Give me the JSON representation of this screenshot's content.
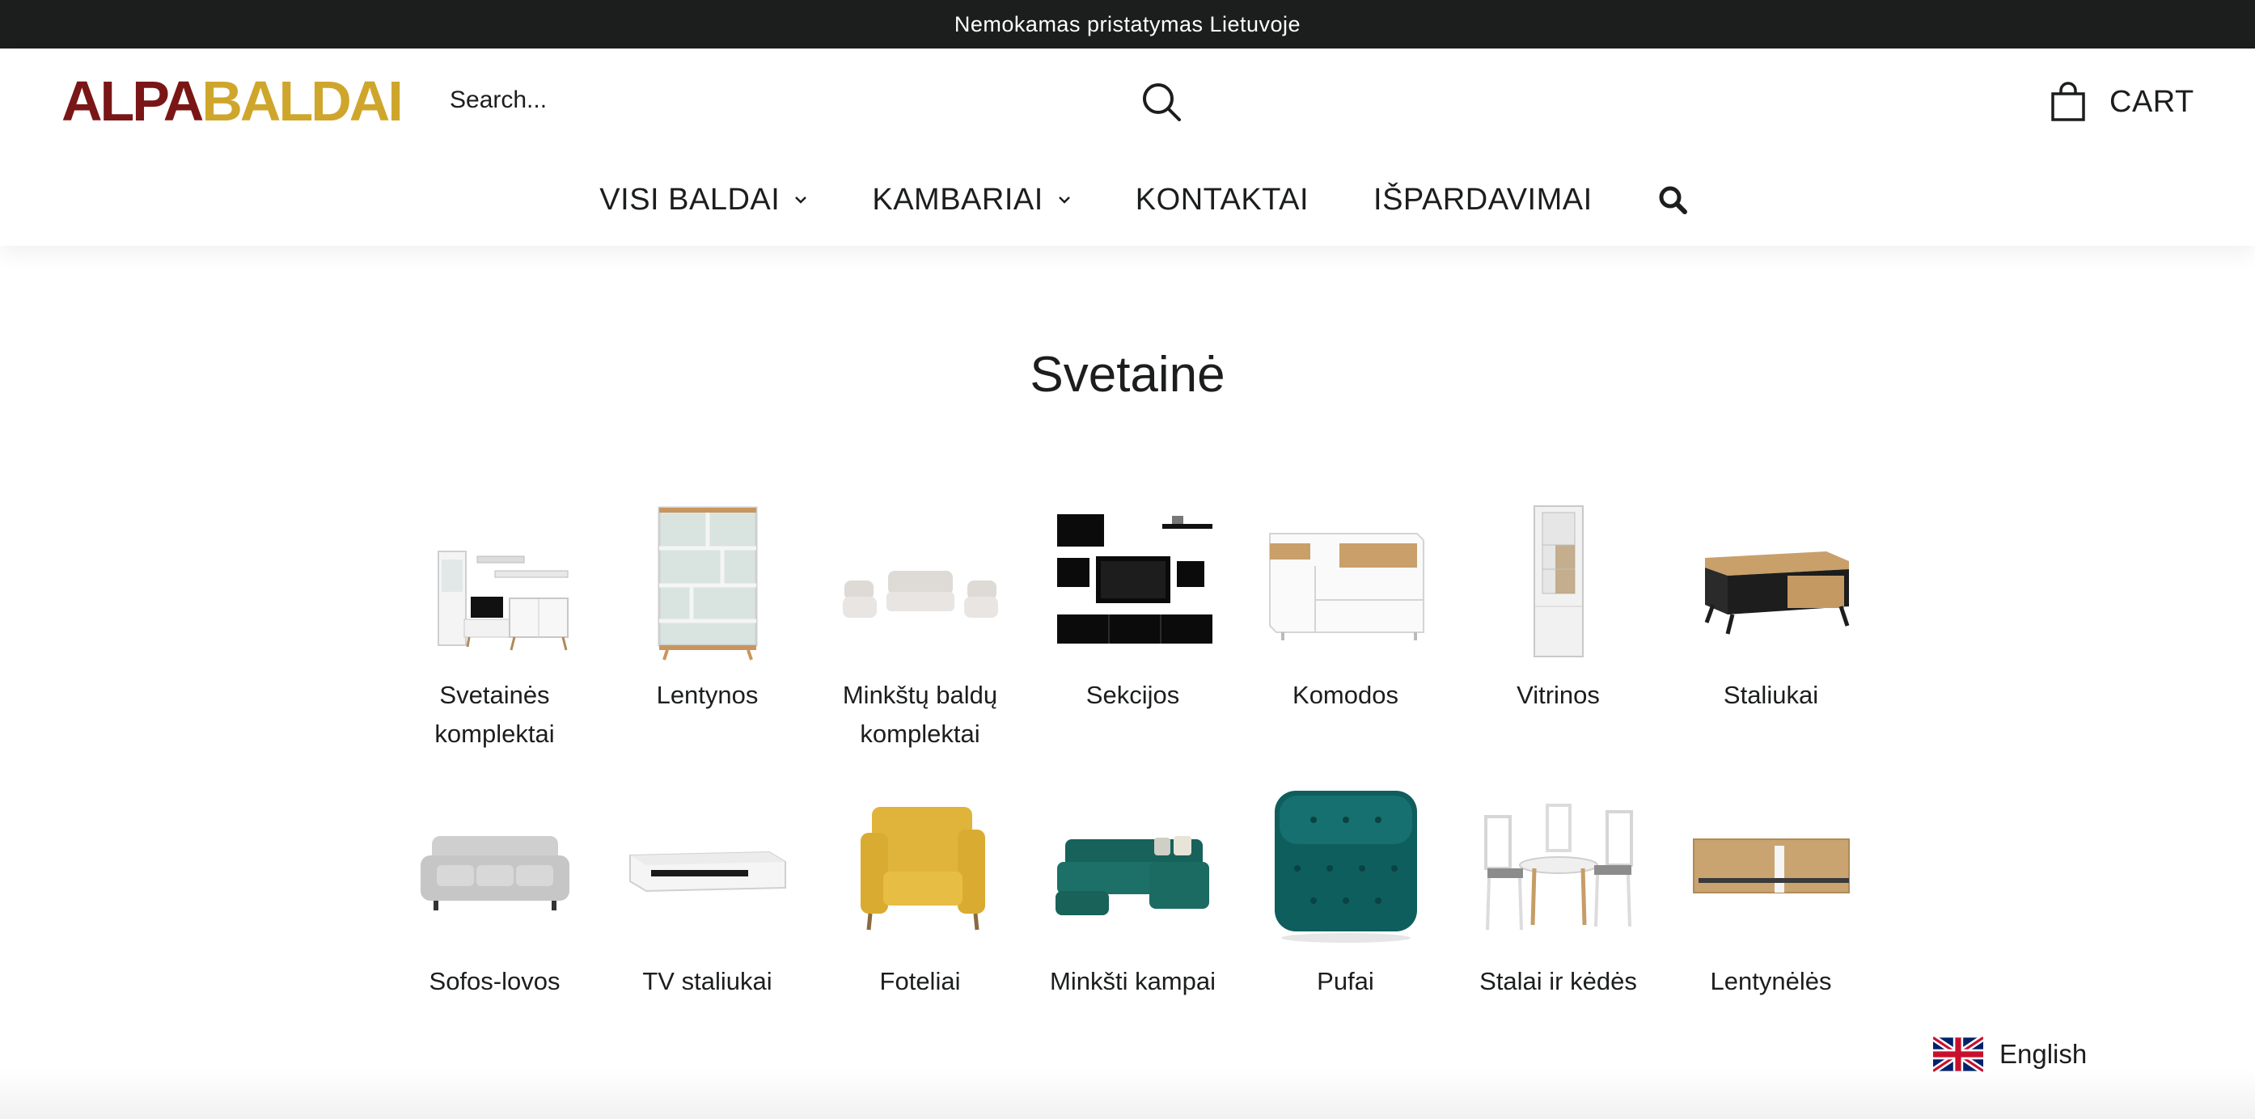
{
  "announcement": "Nemokamas pristatymas Lietuvoje",
  "logo": {
    "part1": "ALPA",
    "part2": "BALDAI",
    "color1": "#7a1616",
    "color2": "#cfa62c"
  },
  "search": {
    "placeholder": "Search..."
  },
  "cart": {
    "label": "CART"
  },
  "nav": [
    {
      "label": "VISI BALDAI",
      "dropdown": true
    },
    {
      "label": "KAMBARIAI",
      "dropdown": true
    },
    {
      "label": "KONTAKTAI",
      "dropdown": false
    },
    {
      "label": "IŠPARDAVIMAI",
      "dropdown": false
    }
  ],
  "page_title": "Svetainė",
  "categories": [
    {
      "label": "Svetainės komplektai",
      "icon": "living-room-set-icon"
    },
    {
      "label": "Lentynos",
      "icon": "bookshelf-icon"
    },
    {
      "label": "Minkštų baldų komplektai",
      "icon": "sofa-set-icon"
    },
    {
      "label": "Sekcijos",
      "icon": "wall-unit-icon"
    },
    {
      "label": "Komodos",
      "icon": "dresser-icon"
    },
    {
      "label": "Vitrinos",
      "icon": "display-cabinet-icon"
    },
    {
      "label": "Staliukai",
      "icon": "coffee-table-icon"
    },
    {
      "label": "Sofos-lovos",
      "icon": "sofa-bed-icon"
    },
    {
      "label": "TV staliukai",
      "icon": "tv-stand-icon"
    },
    {
      "label": "Foteliai",
      "icon": "armchair-icon"
    },
    {
      "label": "Minkšti kampai",
      "icon": "corner-sofa-icon"
    },
    {
      "label": "Pufai",
      "icon": "pouf-icon"
    },
    {
      "label": "Stalai ir kėdės",
      "icon": "table-chairs-icon"
    },
    {
      "label": "Lentynėlės",
      "icon": "wall-shelf-icon"
    }
  ],
  "language": {
    "label": "English",
    "flag": "uk-flag-icon"
  }
}
